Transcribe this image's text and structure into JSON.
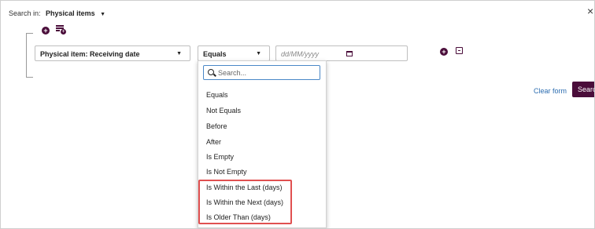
{
  "search_in": {
    "prefix": "Search in:",
    "scope": "Physical items",
    "caret": "▼"
  },
  "close_label": "×",
  "criteria": {
    "add_condition": "+",
    "field_select": "Physical item: Receiving date",
    "operator_select": "Equals",
    "date_placeholder": "dd/MM/yyyy",
    "caret": "▼"
  },
  "actions": {
    "clear_form": "Clear form",
    "search": "Search"
  },
  "dropdown": {
    "search_placeholder": "Search...",
    "options": [
      "Equals",
      "Not Equals",
      "Before",
      "After",
      "Is Empty",
      "Is Not Empty",
      "Is Within the Last (days)",
      "Is Within the Next (days)",
      "Is Older Than (days)"
    ]
  },
  "colors": {
    "accent": "#4a0d3a",
    "link": "#2b6cb0",
    "highlight": "#e05050"
  }
}
